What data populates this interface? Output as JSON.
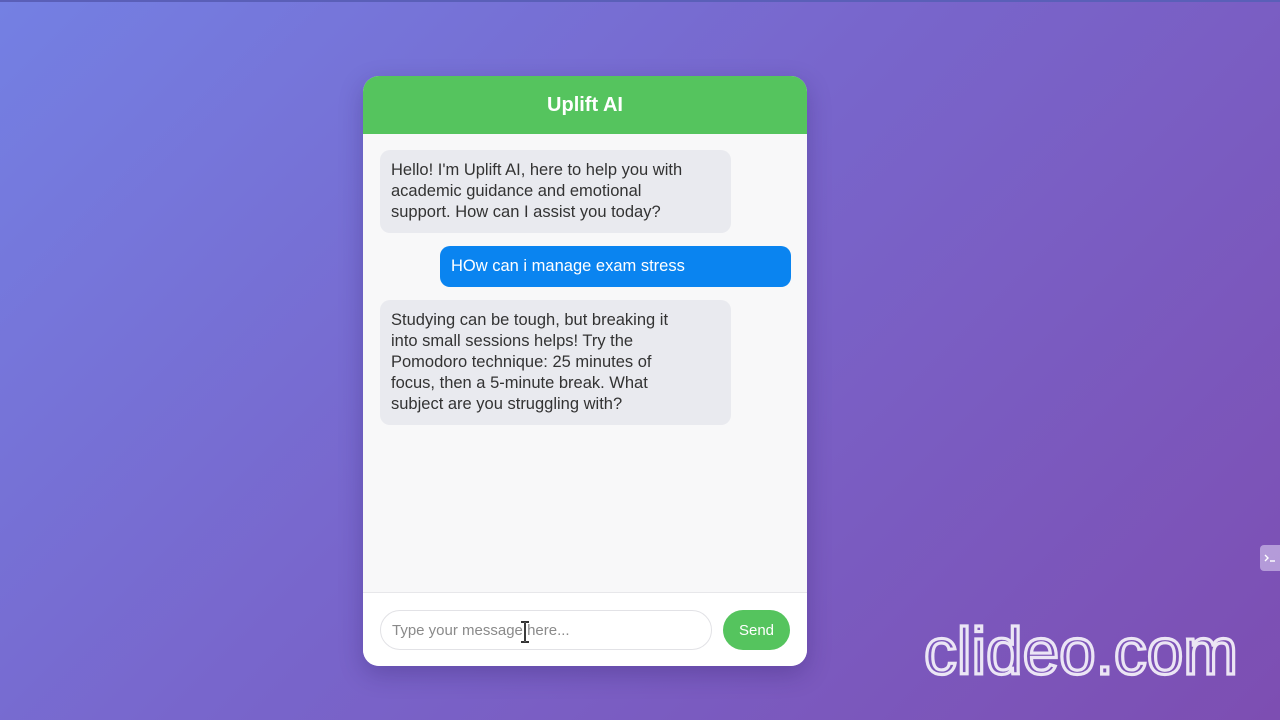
{
  "app": {
    "title": "Uplift AI"
  },
  "messages": [
    {
      "role": "bot",
      "lines": [
        "Hello! I'm Uplift AI, here to help you with",
        "academic guidance and emotional",
        "support. How can I assist you today?"
      ]
    },
    {
      "role": "user",
      "lines": [
        "HOw can i manage exam stress"
      ]
    },
    {
      "role": "bot",
      "lines": [
        "Studying can be tough, but breaking it",
        "into small sessions helps! Try the",
        "Pomodoro technique: 25 minutes of",
        "focus, then a 5-minute break. What",
        "subject are you struggling with?"
      ]
    }
  ],
  "composer": {
    "placeholder": "Type your message here...",
    "value": "",
    "send_label": "Send"
  },
  "watermark": {
    "text": "clideo.com"
  },
  "icons": {
    "side_tab": "terminal-icon",
    "cursor": "text-cursor-icon"
  },
  "colors": {
    "accent": "#55c45e",
    "user_bubble": "#0a84f0",
    "bot_bubble": "#e9eaef",
    "background_start": "#7480e3",
    "background_end": "#7d4eb2"
  }
}
